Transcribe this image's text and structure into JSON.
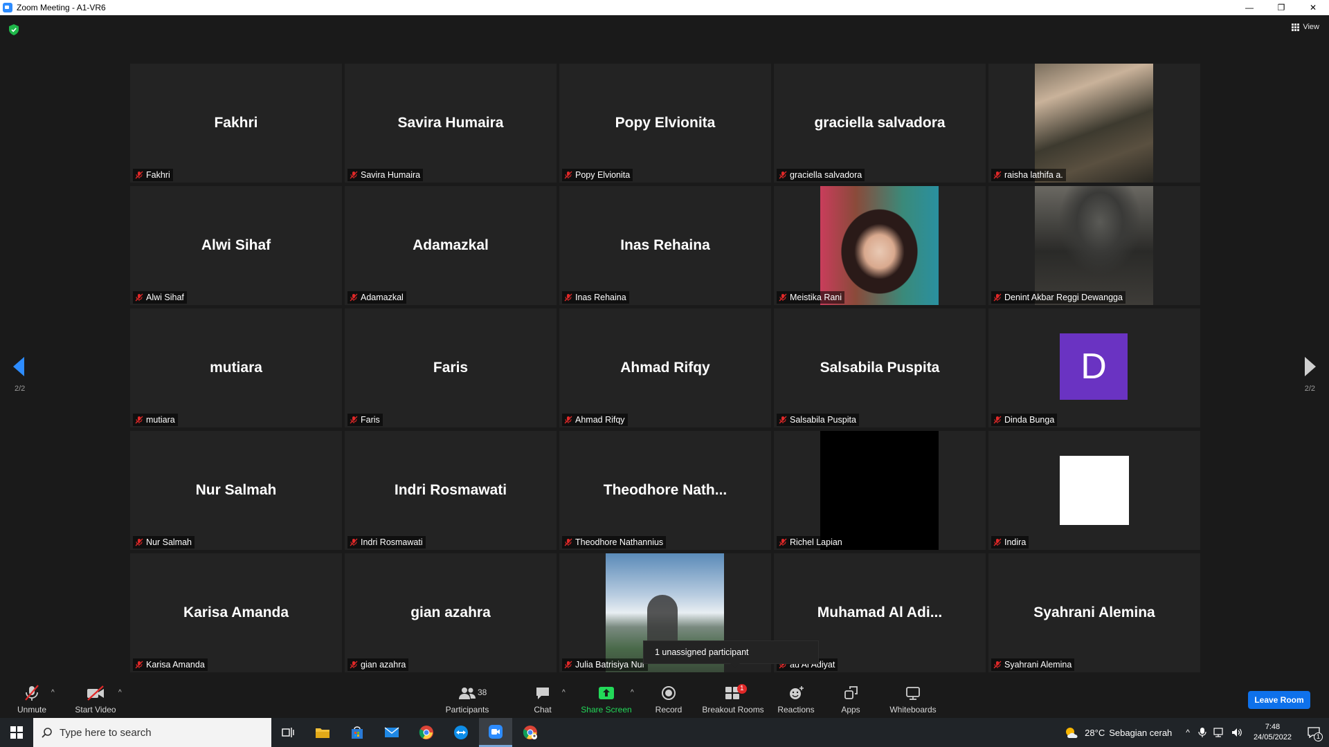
{
  "window": {
    "title": "Zoom Meeting - A1-VR6",
    "minimize": "—",
    "restore": "❐",
    "close": "✕"
  },
  "view_label": "View",
  "pagination": {
    "left": "2/2",
    "right": "2/2"
  },
  "tiles": [
    {
      "display_name": "Fakhri",
      "label": "Fakhri",
      "kind": "name"
    },
    {
      "display_name": "Savira Humaira",
      "label": "Savira Humaira",
      "kind": "name"
    },
    {
      "display_name": "Popy Elvionita",
      "label": "Popy Elvionita",
      "kind": "name"
    },
    {
      "display_name": "graciella salvadora",
      "label": "graciella salvadora",
      "kind": "name"
    },
    {
      "display_name": "",
      "label": "raisha lathifa a.",
      "kind": "video-group"
    },
    {
      "display_name": "Alwi Sihaf",
      "label": "Alwi Sihaf",
      "kind": "name"
    },
    {
      "display_name": "Adamazkal",
      "label": "Adamazkal",
      "kind": "name"
    },
    {
      "display_name": "Inas Rehaina",
      "label": "Inas Rehaina",
      "kind": "name"
    },
    {
      "display_name": "",
      "label": "Meistika Rani",
      "kind": "video-girl"
    },
    {
      "display_name": "",
      "label": "Denint Akbar Reggi Dewangga",
      "kind": "video-helmet"
    },
    {
      "display_name": "mutiara",
      "label": "mutiara",
      "kind": "name"
    },
    {
      "display_name": "Faris",
      "label": "Faris",
      "kind": "name"
    },
    {
      "display_name": "Ahmad Rifqy",
      "label": "Ahmad Rifqy",
      "kind": "name"
    },
    {
      "display_name": "Salsabila Puspita",
      "label": "Salsabila Puspita",
      "kind": "name"
    },
    {
      "display_name": "D",
      "label": "Dinda Bunga",
      "kind": "avatar"
    },
    {
      "display_name": "Nur Salmah",
      "label": "Nur Salmah",
      "kind": "name"
    },
    {
      "display_name": "Indri Rosmawati",
      "label": "Indri Rosmawati",
      "kind": "name"
    },
    {
      "display_name": "Theodhore  Nath...",
      "label": "Theodhore Nathannius",
      "kind": "name"
    },
    {
      "display_name": "",
      "label": "Richel Lapian",
      "kind": "video-black"
    },
    {
      "display_name": "",
      "label": "Indira",
      "kind": "white-box"
    },
    {
      "display_name": "Karisa Amanda",
      "label": "Karisa Amanda",
      "kind": "name"
    },
    {
      "display_name": "gian azahra",
      "label": "gian azahra",
      "kind": "name"
    },
    {
      "display_name": "",
      "label": "Julia Batrisiya Nur",
      "kind": "video-sky"
    },
    {
      "display_name": "Muhamad  Al  Adi...",
      "label": "ad Al Adiyat",
      "kind": "name"
    },
    {
      "display_name": "Syahrani Alemina",
      "label": "Syahrani Alemina",
      "kind": "name"
    }
  ],
  "tooltip": "1 unassigned participant",
  "toolbar": {
    "unmute": "Unmute",
    "start_video": "Start Video",
    "participants": "Participants",
    "participants_count": "38",
    "chat": "Chat",
    "share_screen": "Share Screen",
    "record": "Record",
    "breakout_rooms": "Breakout Rooms",
    "breakout_badge": "1",
    "reactions": "Reactions",
    "apps": "Apps",
    "whiteboards": "Whiteboards",
    "leave": "Leave Room"
  },
  "taskbar": {
    "search_placeholder": "Type here to search",
    "weather_temp": "28°C",
    "weather_desc": "Sebagian cerah",
    "time": "7:48",
    "date": "24/05/2022",
    "notification_count": "1"
  },
  "colors": {
    "accent_blue": "#0e71eb",
    "share_green": "#23d959",
    "mute_red": "#e02828",
    "avatar_purple": "#6a33c2"
  }
}
